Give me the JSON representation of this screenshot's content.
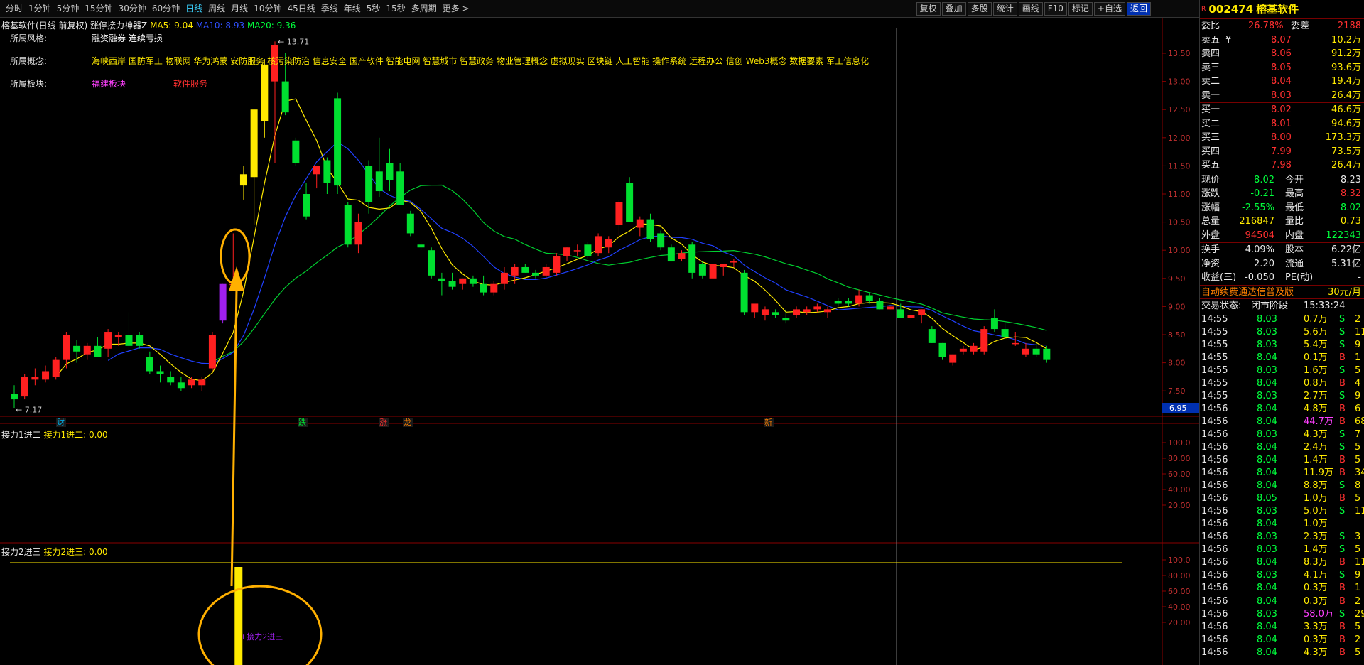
{
  "toolbar": {
    "periods": [
      "分时",
      "1分钟",
      "5分钟",
      "15分钟",
      "30分钟",
      "60分钟",
      "日线",
      "周线",
      "月线",
      "10分钟",
      "45日线",
      "季线",
      "年线",
      "5秒",
      "15秒",
      "多周期",
      "更多 >"
    ],
    "active_period": "日线",
    "actions": [
      "复权",
      "叠加",
      "多股",
      "统计",
      "画线",
      "F10",
      "标记",
      "+自选",
      "返回"
    ]
  },
  "chart_header": {
    "stock_title": "榕基软件(日线 前复权)",
    "indicator_name": "涨停接力神器Z",
    "ma5": "MA5: 9.04",
    "ma10": "MA10: 8.93",
    "ma20": "MA20: 9.36"
  },
  "info": {
    "style_label": "所属风格:",
    "style_value": "融资融券 连续亏损",
    "concept_label": "所属概念:",
    "concept_value": "海峡西岸 国防军工 物联网 华为鸿蒙 安防服务 核污染防治 信息安全 国产软件 智能电网 智慧城市 智慧政务 物业管理概念 虚拟现实 区块链 人工智能 操作系统 远程办公 信创 Web3概念 数据要素 军工信息化",
    "sector_label": "所属板块:",
    "sector_1": "福建板块",
    "sector_2": "软件服务"
  },
  "markers": {
    "high": "13.71",
    "low": "7.17",
    "cursor_price": "6.95",
    "event_1": "财",
    "event_2": "跌",
    "event_3": "涨",
    "event_4": "龙",
    "event_5": "新"
  },
  "sub1": {
    "title": "接力1进二",
    "value": "接力1进二: 0.00"
  },
  "sub2": {
    "title": "接力2进三",
    "value": "接力2进三: 0.00",
    "annotation": "接力2进三"
  },
  "chart_data": {
    "type": "candlestick",
    "y_axis": [
      "13.50",
      "13.00",
      "12.50",
      "12.00",
      "11.50",
      "11.00",
      "10.50",
      "10.00",
      "9.50",
      "9.00",
      "8.50",
      "8.00",
      "7.50"
    ],
    "sub_axis": [
      "100.0",
      "80.00",
      "60.00",
      "40.00",
      "20.00"
    ],
    "candles": [
      [
        7.45,
        7.6,
        7.2,
        7.35
      ],
      [
        7.4,
        7.8,
        7.35,
        7.75
      ],
      [
        7.7,
        7.9,
        7.6,
        7.75
      ],
      [
        7.7,
        7.95,
        7.65,
        7.85
      ],
      [
        7.75,
        8.1,
        7.7,
        8.05
      ],
      [
        8.05,
        8.55,
        7.9,
        8.5
      ],
      [
        8.3,
        8.4,
        8.0,
        8.2
      ],
      [
        8.15,
        8.35,
        8.05,
        8.3
      ],
      [
        8.3,
        8.45,
        8.1,
        8.1
      ],
      [
        8.25,
        8.6,
        8.1,
        8.55
      ],
      [
        8.45,
        8.55,
        8.3,
        8.5
      ],
      [
        8.5,
        8.9,
        8.2,
        8.3
      ],
      [
        8.5,
        8.55,
        8.25,
        8.3
      ],
      [
        8.1,
        8.2,
        7.8,
        7.85
      ],
      [
        7.85,
        7.95,
        7.65,
        7.8
      ],
      [
        7.75,
        7.85,
        7.6,
        7.65
      ],
      [
        7.65,
        7.75,
        7.5,
        7.55
      ],
      [
        7.6,
        7.75,
        7.55,
        7.7
      ],
      [
        7.6,
        7.75,
        7.5,
        7.7
      ],
      [
        7.9,
        8.55,
        7.85,
        8.5
      ],
      [
        8.75,
        9.4,
        8.7,
        9.4
      ],
      [
        9.4,
        10.3,
        9.4,
        9.4
      ],
      [
        11.15,
        11.5,
        10.9,
        11.35
      ],
      [
        11.3,
        12.5,
        10.45,
        12.5
      ],
      [
        12.3,
        13.4,
        12.0,
        13.3
      ],
      [
        13.0,
        13.71,
        11.55,
        13.65
      ],
      [
        13.0,
        13.5,
        12.4,
        12.45
      ],
      [
        11.95,
        12.0,
        11.5,
        11.55
      ],
      [
        11.0,
        11.2,
        10.55,
        10.6
      ],
      [
        11.35,
        11.5,
        11.1,
        11.5
      ],
      [
        11.6,
        11.65,
        11.0,
        11.2
      ],
      [
        12.7,
        12.8,
        11.0,
        11.15
      ],
      [
        10.8,
        10.85,
        10.05,
        10.1
      ],
      [
        10.1,
        10.65,
        9.95,
        10.5
      ],
      [
        11.5,
        11.6,
        10.65,
        10.85
      ],
      [
        11.4,
        12.0,
        10.95,
        11.05
      ],
      [
        11.55,
        11.8,
        11.05,
        11.25
      ],
      [
        11.4,
        11.55,
        10.8,
        10.8
      ],
      [
        10.65,
        10.7,
        10.25,
        10.3
      ],
      [
        10.1,
        10.15,
        10.0,
        10.05
      ],
      [
        10.0,
        10.05,
        9.5,
        9.55
      ],
      [
        9.5,
        9.6,
        9.2,
        9.45
      ],
      [
        9.45,
        9.6,
        9.3,
        9.35
      ],
      [
        9.4,
        9.5,
        9.3,
        9.5
      ],
      [
        9.5,
        9.55,
        9.35,
        9.4
      ],
      [
        9.4,
        9.55,
        9.2,
        9.25
      ],
      [
        9.25,
        9.45,
        9.2,
        9.4
      ],
      [
        9.4,
        9.7,
        9.3,
        9.6
      ],
      [
        9.55,
        9.75,
        9.4,
        9.7
      ],
      [
        9.7,
        9.75,
        9.6,
        9.6
      ],
      [
        9.6,
        9.65,
        9.5,
        9.55
      ],
      [
        9.55,
        9.75,
        9.5,
        9.7
      ],
      [
        9.6,
        9.95,
        9.55,
        9.9
      ],
      [
        9.9,
        10.05,
        9.8,
        10.05
      ],
      [
        10.0,
        10.1,
        9.9,
        10.0
      ],
      [
        10.1,
        10.15,
        9.85,
        9.9
      ],
      [
        9.95,
        10.3,
        9.9,
        10.25
      ],
      [
        10.05,
        10.25,
        9.95,
        10.2
      ],
      [
        10.45,
        10.9,
        10.2,
        10.85
      ],
      [
        11.2,
        11.3,
        10.5,
        10.5
      ],
      [
        10.4,
        10.6,
        10.25,
        10.55
      ],
      [
        10.55,
        10.65,
        10.15,
        10.2
      ],
      [
        10.3,
        10.35,
        10.0,
        10.05
      ],
      [
        10.05,
        10.1,
        9.8,
        9.8
      ],
      [
        9.85,
        10.0,
        9.8,
        9.95
      ],
      [
        10.1,
        10.15,
        9.5,
        9.6
      ],
      [
        9.75,
        9.8,
        9.5,
        9.55
      ],
      [
        9.5,
        9.75,
        9.5,
        9.75
      ],
      [
        9.7,
        9.75,
        9.55,
        9.75
      ],
      [
        9.8,
        9.85,
        9.7,
        9.8
      ],
      [
        9.6,
        9.65,
        8.85,
        8.9
      ],
      [
        8.9,
        9.0,
        8.8,
        9.05
      ],
      [
        8.85,
        9.0,
        8.75,
        8.95
      ],
      [
        8.9,
        8.95,
        8.8,
        8.85
      ],
      [
        8.8,
        8.95,
        8.7,
        8.75
      ],
      [
        8.85,
        9.0,
        8.8,
        8.95
      ],
      [
        8.9,
        9.0,
        8.85,
        8.95
      ],
      [
        8.95,
        9.05,
        8.9,
        9.0
      ],
      [
        8.9,
        9.0,
        8.8,
        8.95
      ],
      [
        9.1,
        9.15,
        9.0,
        9.05
      ],
      [
        9.1,
        9.15,
        9.0,
        9.05
      ],
      [
        9.05,
        9.3,
        9.0,
        9.2
      ],
      [
        9.2,
        9.25,
        9.05,
        9.1
      ],
      [
        9.1,
        9.15,
        8.95,
        8.95
      ],
      [
        8.95,
        9.0,
        8.95,
        9.0
      ],
      [
        8.95,
        9.05,
        8.8,
        8.8
      ],
      [
        8.8,
        8.95,
        8.75,
        8.85
      ],
      [
        8.85,
        8.95,
        8.7,
        8.95
      ],
      [
        8.6,
        8.65,
        8.35,
        8.35
      ],
      [
        8.35,
        8.35,
        8.05,
        8.1
      ],
      [
        8.0,
        8.15,
        7.95,
        8.15
      ],
      [
        8.2,
        8.3,
        8.15,
        8.25
      ],
      [
        8.2,
        8.35,
        8.15,
        8.3
      ],
      [
        8.2,
        8.65,
        8.15,
        8.6
      ],
      [
        8.8,
        8.95,
        8.55,
        8.6
      ],
      [
        8.6,
        8.7,
        8.45,
        8.45
      ],
      [
        8.35,
        8.55,
        8.3,
        8.35
      ],
      [
        8.15,
        8.35,
        8.1,
        8.25
      ],
      [
        8.25,
        8.35,
        8.1,
        8.15
      ],
      [
        8.25,
        8.3,
        8.0,
        8.05
      ]
    ],
    "sub1_bars": [],
    "sub2_bars": [
      {
        "index": 21,
        "value": 100
      }
    ]
  },
  "quote": {
    "code": "002474",
    "name": "榕基软件",
    "r_mark": "R",
    "weibi_label": "委比",
    "weibi": "26.78%",
    "weicha_label": "委差",
    "weicha": "2188",
    "asks": [
      {
        "label": "卖五",
        "price": "8.07",
        "vol": "10.2万"
      },
      {
        "label": "卖四",
        "price": "8.06",
        "vol": "91.2万"
      },
      {
        "label": "卖三",
        "price": "8.05",
        "vol": "93.6万"
      },
      {
        "label": "卖二",
        "price": "8.04",
        "vol": "19.4万"
      },
      {
        "label": "卖一",
        "price": "8.03",
        "vol": "26.4万"
      }
    ],
    "ask_mark": "¥",
    "bids": [
      {
        "label": "买一",
        "price": "8.02",
        "vol": "46.6万"
      },
      {
        "label": "买二",
        "price": "8.01",
        "vol": "94.6万"
      },
      {
        "label": "买三",
        "price": "8.00",
        "vol": "173.3万"
      },
      {
        "label": "买四",
        "price": "7.99",
        "vol": "73.5万"
      },
      {
        "label": "买五",
        "price": "7.98",
        "vol": "26.4万"
      }
    ],
    "stats": [
      {
        "l1": "现价",
        "v1": "8.02",
        "c1": "green",
        "l2": "今开",
        "v2": "8.23",
        "c2": "wh"
      },
      {
        "l1": "涨跌",
        "v1": "-0.21",
        "c1": "green",
        "l2": "最高",
        "v2": "8.32",
        "c2": "red"
      },
      {
        "l1": "涨幅",
        "v1": "-2.55%",
        "c1": "green",
        "l2": "最低",
        "v2": "8.02",
        "c2": "green"
      },
      {
        "l1": "总量",
        "v1": "216847",
        "c1": "yel",
        "l2": "量比",
        "v2": "0.73",
        "c2": "yel"
      },
      {
        "l1": "外盘",
        "v1": "94504",
        "c1": "red",
        "l2": "内盘",
        "v2": "122343",
        "c2": "green"
      }
    ],
    "stats2": [
      {
        "l1": "换手",
        "v1": "4.09%",
        "l2": "股本",
        "v2": "6.22亿"
      },
      {
        "l1": "净资",
        "v1": "2.20",
        "l2": "流通",
        "v2": "5.31亿"
      },
      {
        "l1": "收益(三)",
        "v1": "-0.050",
        "l2": "PE(动)",
        "v2": "-"
      }
    ],
    "promo": "自动续费通达信普及版",
    "promo_price": "30元/月",
    "trade_status_label": "交易状态:",
    "trade_status": "闭市阶段",
    "trade_time": "15:33:24",
    "ticks": [
      [
        "14:55",
        "8.03",
        "0.7万",
        "S",
        "2"
      ],
      [
        "14:55",
        "8.03",
        "5.6万",
        "S",
        "11"
      ],
      [
        "14:55",
        "8.03",
        "5.4万",
        "S",
        "9"
      ],
      [
        "14:55",
        "8.04",
        "0.1万",
        "B",
        "1"
      ],
      [
        "14:55",
        "8.03",
        "1.6万",
        "S",
        "5"
      ],
      [
        "14:55",
        "8.04",
        "0.8万",
        "B",
        "4"
      ],
      [
        "14:55",
        "8.03",
        "2.7万",
        "S",
        "9"
      ],
      [
        "14:56",
        "8.04",
        "4.8万",
        "B",
        "6"
      ],
      [
        "14:56",
        "8.04",
        "44.7万",
        "B",
        "68"
      ],
      [
        "14:56",
        "8.03",
        "4.3万",
        "S",
        "7"
      ],
      [
        "14:56",
        "8.04",
        "2.4万",
        "S",
        "5"
      ],
      [
        "14:56",
        "8.04",
        "1.4万",
        "B",
        "5"
      ],
      [
        "14:56",
        "8.04",
        "11.9万",
        "B",
        "34"
      ],
      [
        "14:56",
        "8.04",
        "8.8万",
        "S",
        "8"
      ],
      [
        "14:56",
        "8.05",
        "1.0万",
        "B",
        "5"
      ],
      [
        "14:56",
        "8.03",
        "5.0万",
        "S",
        "11"
      ],
      [
        "14:56",
        "8.04",
        "1.0万",
        "",
        ""
      ],
      [
        "14:56",
        "8.03",
        "2.3万",
        "S",
        "3"
      ],
      [
        "14:56",
        "8.03",
        "1.4万",
        "S",
        "5"
      ],
      [
        "14:56",
        "8.04",
        "8.3万",
        "B",
        "11"
      ],
      [
        "14:56",
        "8.03",
        "4.1万",
        "S",
        "9"
      ],
      [
        "14:56",
        "8.04",
        "0.3万",
        "B",
        "1"
      ],
      [
        "14:56",
        "8.04",
        "0.3万",
        "B",
        "2"
      ],
      [
        "14:56",
        "8.03",
        "58.0万",
        "S",
        "29"
      ],
      [
        "14:56",
        "8.04",
        "3.3万",
        "B",
        "5"
      ],
      [
        "14:56",
        "8.04",
        "0.3万",
        "B",
        "2"
      ],
      [
        "14:56",
        "8.04",
        "4.3万",
        "B",
        "5"
      ]
    ]
  }
}
